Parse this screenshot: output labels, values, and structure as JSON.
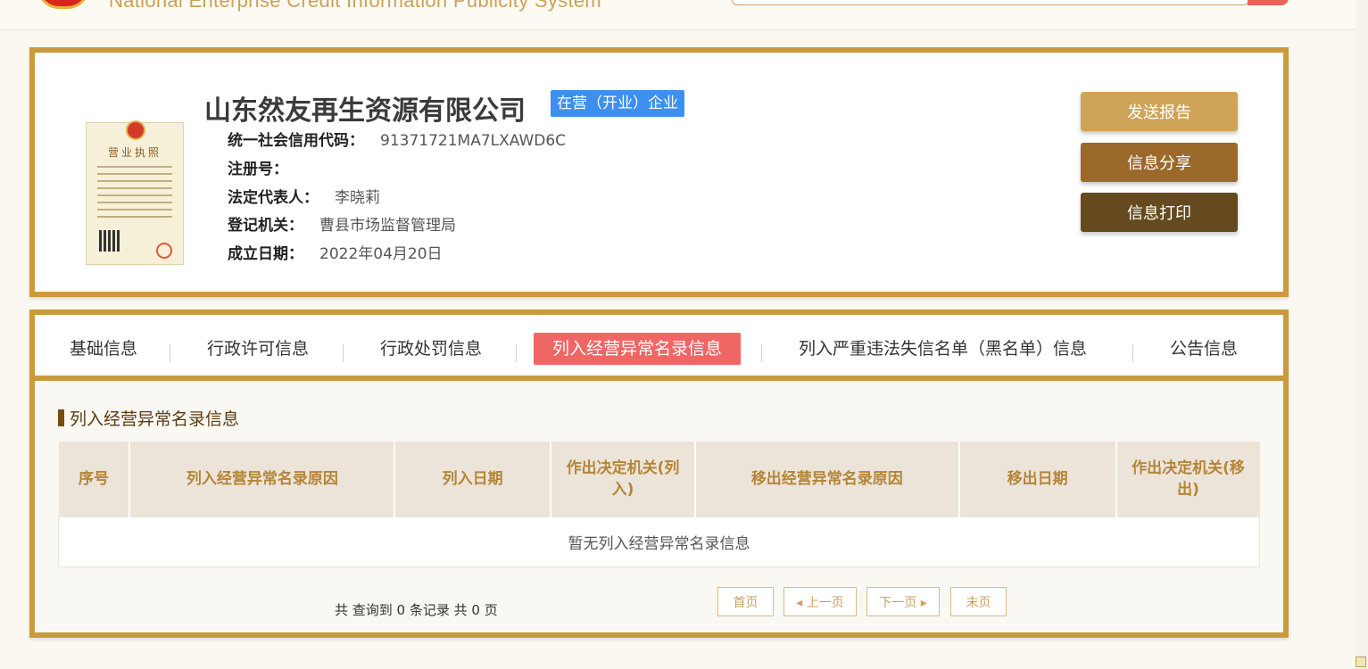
{
  "header": {
    "system_name": "National Enterprise Credit Information Publicity System"
  },
  "company": {
    "name": "山东然友再生资源有限公司",
    "status": "在营（开业）企业",
    "fields": {
      "credit_code": {
        "label": "统一社会信用代码：",
        "value": "91371721MA7LXAWD6C"
      },
      "reg_no": {
        "label": "注册号：",
        "value": ""
      },
      "legal_rep": {
        "label": "法定代表人：",
        "value": "李晓莉"
      },
      "authority": {
        "label": "登记机关：",
        "value": "曹县市场监督管理局"
      },
      "founded": {
        "label": "成立日期：",
        "value": "2022年04月20日"
      }
    },
    "license_title": "营业执照"
  },
  "actions": {
    "send_report": "发送报告",
    "share": "信息分享",
    "print": "信息打印"
  },
  "tabs": [
    {
      "label": "基础信息",
      "active": false
    },
    {
      "label": "行政许可信息",
      "active": false
    },
    {
      "label": "行政处罚信息",
      "active": false
    },
    {
      "label": "列入经营异常名录信息",
      "active": true
    },
    {
      "label": "列入严重违法失信名单（黑名单）信息",
      "active": false
    },
    {
      "label": "公告信息",
      "active": false
    }
  ],
  "section": {
    "title": "列入经营异常名录信息",
    "columns": [
      "序号",
      "列入经营异常名录原因",
      "列入日期",
      "作出决定机关(列入)",
      "移出经营异常名录原因",
      "移出日期",
      "作出决定机关(移出)"
    ],
    "empty_text": "暂无列入经营异常名录信息"
  },
  "pagination": {
    "summary": "共 查询到 0 条记录 共 0 页",
    "first": "首页",
    "prev": "上一页",
    "next": "下一页",
    "last": "末页"
  },
  "colors": {
    "frame": "#c99b3d",
    "active_tab": "#f06665",
    "status_badge": "#3d8ff0",
    "btn_report": "#cfa459",
    "btn_share": "#9b6a2b",
    "btn_print": "#644a1e"
  }
}
